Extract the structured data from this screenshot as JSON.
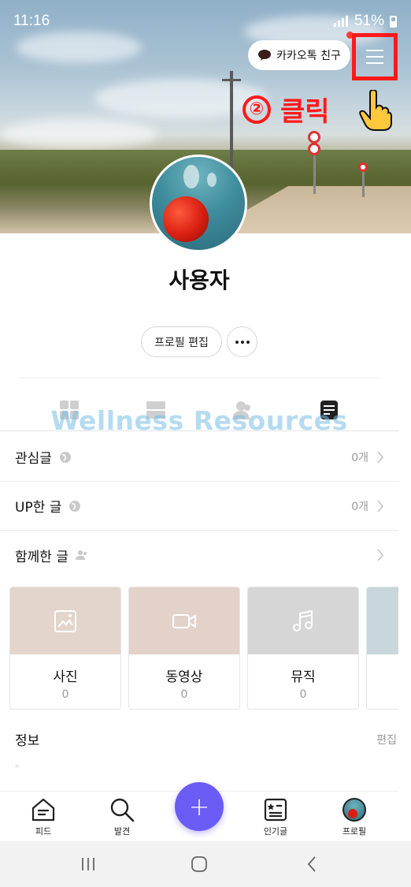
{
  "status_bar": {
    "time": "11:16",
    "battery": "51%"
  },
  "header": {
    "kakao_friend_label": "카카오톡 친구",
    "annotation_number": "②",
    "annotation_text": "클릭"
  },
  "profile": {
    "name": "사용자",
    "edit_label": "프로필 편집"
  },
  "watermark": "Wellness Resources",
  "tabs": [
    {
      "icon": "grid-icon"
    },
    {
      "icon": "list-view-icon"
    },
    {
      "icon": "friends-icon"
    },
    {
      "icon": "document-icon",
      "active": true
    }
  ],
  "list": [
    {
      "label": "관심글",
      "icon": "public-icon",
      "count": "0개"
    },
    {
      "label": "UP한 글",
      "icon": "public-icon",
      "count": "0개"
    },
    {
      "label": "함께한 글",
      "icon": "people-icon",
      "count": ""
    }
  ],
  "media_cards": [
    {
      "title": "사진",
      "count": "0",
      "icon": "photo-icon",
      "color": "#e3d5cb"
    },
    {
      "title": "동영상",
      "count": "0",
      "icon": "video-icon",
      "color": "#e3d2ca"
    },
    {
      "title": "뮤직",
      "count": "0",
      "icon": "music-icon",
      "color": "#d7d6d6"
    },
    {
      "title": "",
      "count": "",
      "icon": "",
      "color": "#c9d7dc"
    }
  ],
  "info": {
    "title": "정보",
    "edit_label": "편집"
  },
  "bottom_nav": {
    "feed": "피드",
    "discover": "발견",
    "popular": "인기글",
    "profile": "프로필",
    "fab": "+"
  },
  "colors": {
    "accent": "#6b5cf6",
    "annotation_red": "#ff1a1a"
  }
}
